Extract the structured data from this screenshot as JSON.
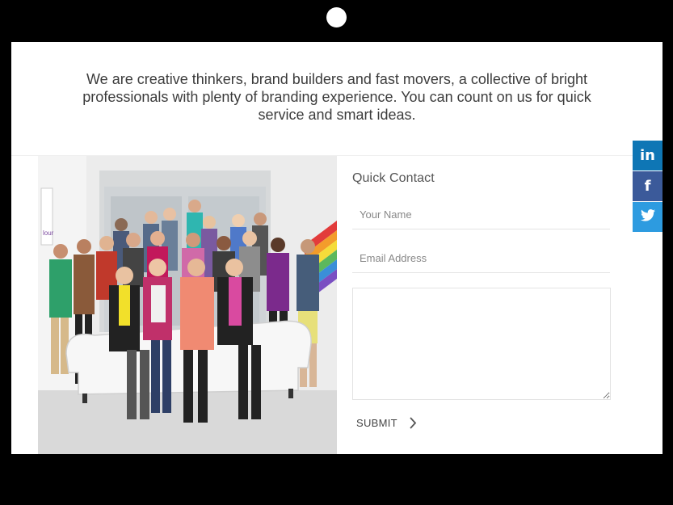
{
  "intro": {
    "text": "We are creative thinkers, brand builders and fast movers, a collective of bright professionals with plenty of branding experience. You can count on us for quick service and smart ideas."
  },
  "photo": {
    "sign_text": "lour"
  },
  "quick_contact": {
    "title": "Quick Contact",
    "name_placeholder": "Your Name",
    "email_placeholder": "Email Address",
    "message_value": "",
    "submit_label": "SUBMIT",
    "submit_icon": "chevron-right-icon"
  },
  "social": {
    "items": [
      {
        "icon": "linkedin-icon",
        "glyph": "in",
        "color": "#0e76b5"
      },
      {
        "icon": "facebook-icon",
        "glyph": "f",
        "color": "#3b5a9a"
      },
      {
        "icon": "twitter-icon",
        "glyph": "",
        "color": "#2d9be0"
      }
    ]
  }
}
